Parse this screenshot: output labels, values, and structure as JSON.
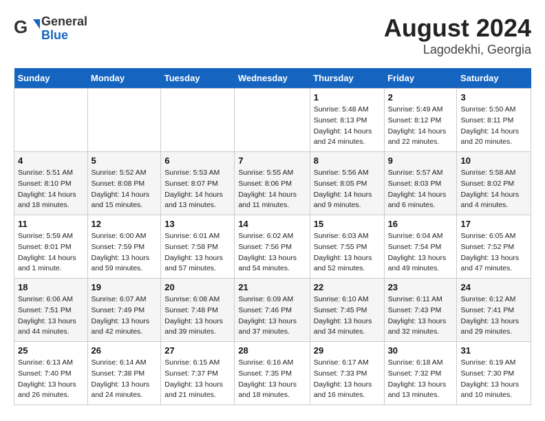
{
  "header": {
    "logo_general": "General",
    "logo_blue": "Blue",
    "main_title": "August 2024",
    "subtitle": "Lagodekhi, Georgia"
  },
  "weekdays": [
    "Sunday",
    "Monday",
    "Tuesday",
    "Wednesday",
    "Thursday",
    "Friday",
    "Saturday"
  ],
  "weeks": [
    [
      {
        "day": "",
        "info": ""
      },
      {
        "day": "",
        "info": ""
      },
      {
        "day": "",
        "info": ""
      },
      {
        "day": "",
        "info": ""
      },
      {
        "day": "1",
        "info": "Sunrise: 5:48 AM\nSunset: 8:13 PM\nDaylight: 14 hours\nand 24 minutes."
      },
      {
        "day": "2",
        "info": "Sunrise: 5:49 AM\nSunset: 8:12 PM\nDaylight: 14 hours\nand 22 minutes."
      },
      {
        "day": "3",
        "info": "Sunrise: 5:50 AM\nSunset: 8:11 PM\nDaylight: 14 hours\nand 20 minutes."
      }
    ],
    [
      {
        "day": "4",
        "info": "Sunrise: 5:51 AM\nSunset: 8:10 PM\nDaylight: 14 hours\nand 18 minutes."
      },
      {
        "day": "5",
        "info": "Sunrise: 5:52 AM\nSunset: 8:08 PM\nDaylight: 14 hours\nand 15 minutes."
      },
      {
        "day": "6",
        "info": "Sunrise: 5:53 AM\nSunset: 8:07 PM\nDaylight: 14 hours\nand 13 minutes."
      },
      {
        "day": "7",
        "info": "Sunrise: 5:55 AM\nSunset: 8:06 PM\nDaylight: 14 hours\nand 11 minutes."
      },
      {
        "day": "8",
        "info": "Sunrise: 5:56 AM\nSunset: 8:05 PM\nDaylight: 14 hours\nand 9 minutes."
      },
      {
        "day": "9",
        "info": "Sunrise: 5:57 AM\nSunset: 8:03 PM\nDaylight: 14 hours\nand 6 minutes."
      },
      {
        "day": "10",
        "info": "Sunrise: 5:58 AM\nSunset: 8:02 PM\nDaylight: 14 hours\nand 4 minutes."
      }
    ],
    [
      {
        "day": "11",
        "info": "Sunrise: 5:59 AM\nSunset: 8:01 PM\nDaylight: 14 hours\nand 1 minute."
      },
      {
        "day": "12",
        "info": "Sunrise: 6:00 AM\nSunset: 7:59 PM\nDaylight: 13 hours\nand 59 minutes."
      },
      {
        "day": "13",
        "info": "Sunrise: 6:01 AM\nSunset: 7:58 PM\nDaylight: 13 hours\nand 57 minutes."
      },
      {
        "day": "14",
        "info": "Sunrise: 6:02 AM\nSunset: 7:56 PM\nDaylight: 13 hours\nand 54 minutes."
      },
      {
        "day": "15",
        "info": "Sunrise: 6:03 AM\nSunset: 7:55 PM\nDaylight: 13 hours\nand 52 minutes."
      },
      {
        "day": "16",
        "info": "Sunrise: 6:04 AM\nSunset: 7:54 PM\nDaylight: 13 hours\nand 49 minutes."
      },
      {
        "day": "17",
        "info": "Sunrise: 6:05 AM\nSunset: 7:52 PM\nDaylight: 13 hours\nand 47 minutes."
      }
    ],
    [
      {
        "day": "18",
        "info": "Sunrise: 6:06 AM\nSunset: 7:51 PM\nDaylight: 13 hours\nand 44 minutes."
      },
      {
        "day": "19",
        "info": "Sunrise: 6:07 AM\nSunset: 7:49 PM\nDaylight: 13 hours\nand 42 minutes."
      },
      {
        "day": "20",
        "info": "Sunrise: 6:08 AM\nSunset: 7:48 PM\nDaylight: 13 hours\nand 39 minutes."
      },
      {
        "day": "21",
        "info": "Sunrise: 6:09 AM\nSunset: 7:46 PM\nDaylight: 13 hours\nand 37 minutes."
      },
      {
        "day": "22",
        "info": "Sunrise: 6:10 AM\nSunset: 7:45 PM\nDaylight: 13 hours\nand 34 minutes."
      },
      {
        "day": "23",
        "info": "Sunrise: 6:11 AM\nSunset: 7:43 PM\nDaylight: 13 hours\nand 32 minutes."
      },
      {
        "day": "24",
        "info": "Sunrise: 6:12 AM\nSunset: 7:41 PM\nDaylight: 13 hours\nand 29 minutes."
      }
    ],
    [
      {
        "day": "25",
        "info": "Sunrise: 6:13 AM\nSunset: 7:40 PM\nDaylight: 13 hours\nand 26 minutes."
      },
      {
        "day": "26",
        "info": "Sunrise: 6:14 AM\nSunset: 7:38 PM\nDaylight: 13 hours\nand 24 minutes."
      },
      {
        "day": "27",
        "info": "Sunrise: 6:15 AM\nSunset: 7:37 PM\nDaylight: 13 hours\nand 21 minutes."
      },
      {
        "day": "28",
        "info": "Sunrise: 6:16 AM\nSunset: 7:35 PM\nDaylight: 13 hours\nand 18 minutes."
      },
      {
        "day": "29",
        "info": "Sunrise: 6:17 AM\nSunset: 7:33 PM\nDaylight: 13 hours\nand 16 minutes."
      },
      {
        "day": "30",
        "info": "Sunrise: 6:18 AM\nSunset: 7:32 PM\nDaylight: 13 hours\nand 13 minutes."
      },
      {
        "day": "31",
        "info": "Sunrise: 6:19 AM\nSunset: 7:30 PM\nDaylight: 13 hours\nand 10 minutes."
      }
    ]
  ]
}
